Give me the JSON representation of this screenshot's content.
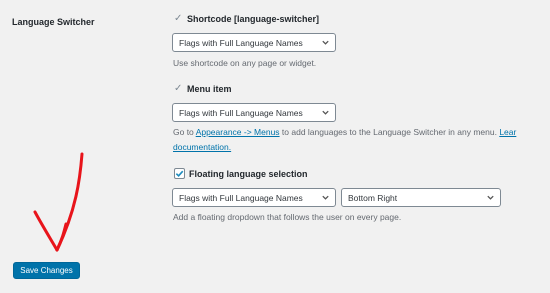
{
  "section_label": "Language Switcher",
  "shortcode": {
    "title": "Shortcode [language-switcher]",
    "select_value": "Flags with Full Language Names",
    "description": "Use shortcode on any page or widget."
  },
  "menu_item": {
    "title": "Menu item",
    "select_value": "Flags with Full Language Names",
    "description_before": "Go to ",
    "link_text": "Appearance -> Menus",
    "description_after": " to add languages to the Language Switcher in any menu. ",
    "link2_text_line1": "Lear",
    "link2_text_line2": "documentation."
  },
  "floating": {
    "title": "Floating language selection",
    "checked": true,
    "select_value": "Flags with Full Language Names",
    "position_value": "Bottom Right",
    "description": "Add a floating dropdown that follows the user on every page."
  },
  "save_button_label": "Save Changes",
  "colors": {
    "accent": "#0073aa",
    "arrow": "#e8141b",
    "background": "#f1f1f1"
  },
  "icons": {
    "check": "checkmark-icon",
    "dropdown": "chevron-down-icon",
    "annotation": "red-hand-drawn-arrow"
  }
}
